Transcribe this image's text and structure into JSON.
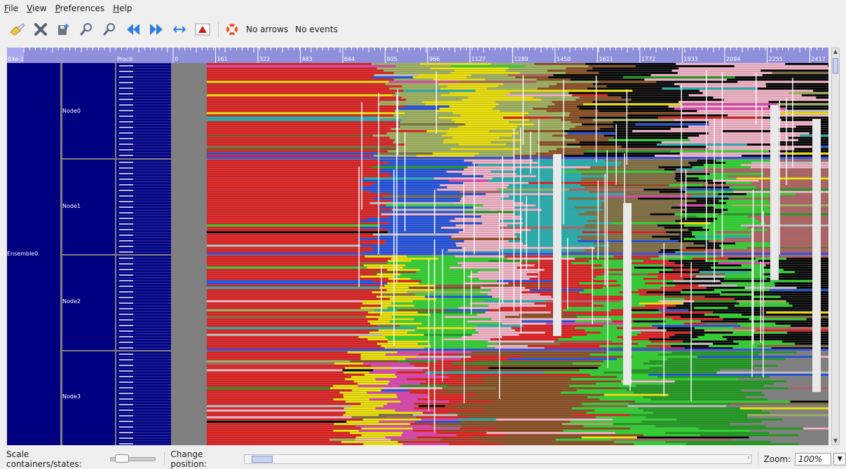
{
  "menubar": {
    "items": [
      {
        "mnemonic": "F",
        "rest": "ile"
      },
      {
        "mnemonic": "V",
        "rest": "iew"
      },
      {
        "mnemonic": "P",
        "rest": "references"
      },
      {
        "mnemonic": "H",
        "rest": "elp"
      }
    ]
  },
  "toolbar": {
    "icons": [
      "open-trace-icon",
      "close-icon",
      "export-icon",
      "zoom-in-icon",
      "zoom-out-icon",
      "previous-icon",
      "next-icon",
      "fit-width-icon",
      "triangle-up-icon",
      "help-lifebuoy-icon"
    ],
    "arrows_label": "No arrows",
    "events_label": "No events"
  },
  "ruler": {
    "start_label": "0Xe-1",
    "ticks": [
      "0",
      "161",
      "322",
      "483",
      "644",
      "805",
      "966",
      "1127",
      "1289",
      "1450",
      "1611",
      "1772",
      "1933",
      "2094",
      "2255",
      "2417"
    ],
    "tick_values": [
      0,
      161,
      322,
      483,
      644,
      805,
      966,
      1127,
      1289,
      1450,
      1611,
      1772,
      1933,
      2094,
      2255,
      2417
    ],
    "first_label": "Proc0"
  },
  "hierarchy": {
    "ensemble": "Ensemble0",
    "nodes": [
      "Node0",
      "Node1",
      "Node2",
      "Node3"
    ]
  },
  "colors": {
    "container": "#000080",
    "ruler": "#8f90dc",
    "background": "#808080",
    "state_palette": [
      "#e01c1c",
      "#f0e400",
      "#9eb35b",
      "#000000",
      "#8a4b1d",
      "#f6b4c8",
      "#1a9a1a",
      "#2bd52b",
      "#2050e0",
      "#e040b0",
      "#20b0b0",
      "#806c3c",
      "#b06060",
      "#c0c0c0"
    ]
  },
  "statusbar": {
    "scale_label": "Scale containers/states:",
    "position_label": "Change position:",
    "zoom_label": "Zoom:",
    "zoom_value": "100%"
  }
}
